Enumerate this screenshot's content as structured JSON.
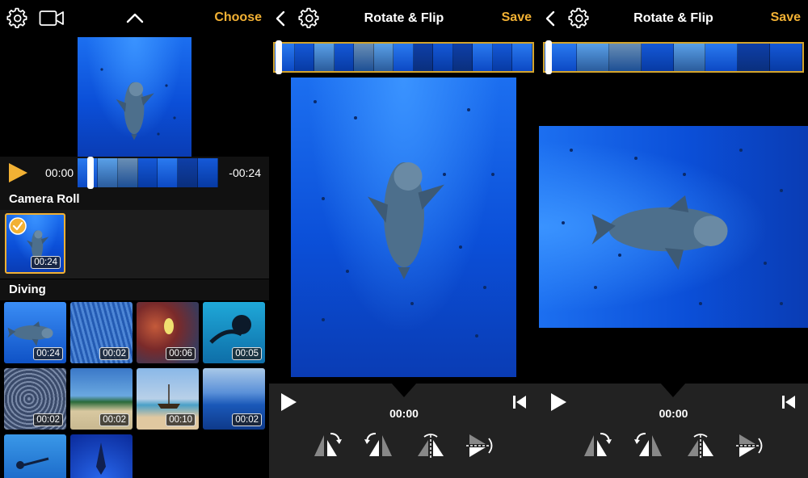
{
  "picker": {
    "choose_label": "Choose",
    "time_start": "00:00",
    "time_end": "-00:24",
    "camera_roll": {
      "title": "Camera Roll",
      "items": [
        {
          "duration": "00:24"
        }
      ]
    },
    "diving": {
      "title": "Diving",
      "items": [
        {
          "duration": "00:24"
        },
        {
          "duration": "00:02"
        },
        {
          "duration": "00:06"
        },
        {
          "duration": "00:05"
        },
        {
          "duration": "00:02"
        },
        {
          "duration": "00:02"
        },
        {
          "duration": "00:10"
        },
        {
          "duration": "00:02"
        }
      ]
    }
  },
  "editor_portrait": {
    "title": "Rotate & Flip",
    "save_label": "Save",
    "time": "00:00"
  },
  "editor_landscape": {
    "title": "Rotate & Flip",
    "save_label": "Save",
    "time": "00:00"
  },
  "colors": {
    "accent": "#f2b134",
    "ocean": "#0b4fd8",
    "control_bar": "#222222"
  },
  "icons": [
    "gear-icon",
    "video-camera-icon",
    "chevron-up-icon",
    "chevron-left-icon",
    "play-icon",
    "skip-to-start-icon",
    "rotate-left-icon",
    "rotate-right-icon",
    "flip-horizontal-icon",
    "flip-vertical-icon",
    "checkmark-icon"
  ]
}
